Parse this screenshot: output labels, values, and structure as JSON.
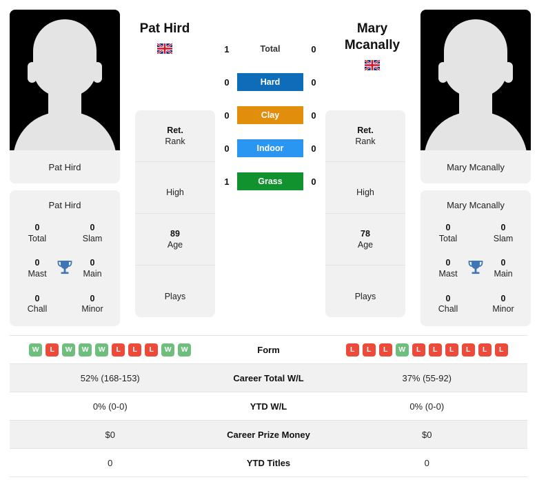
{
  "players": {
    "left": {
      "name": "Pat Hird",
      "name_line1": "Pat Hird",
      "name_line2": "",
      "photo_caption": "Pat Hird",
      "flag": "gb-flag-icon",
      "titles": [
        {
          "value": "0",
          "label": "Total"
        },
        {
          "value": "0",
          "label": "Slam"
        },
        {
          "value": "0",
          "label": "Mast"
        },
        {
          "value": "0",
          "label": "Main"
        },
        {
          "value": "0",
          "label": "Chall"
        },
        {
          "value": "0",
          "label": "Minor"
        }
      ],
      "info": [
        {
          "value": "Ret.",
          "label": "Rank"
        },
        {
          "value": "",
          "label": "High"
        },
        {
          "value": "89",
          "label": "Age"
        },
        {
          "value": "",
          "label": "Plays"
        }
      ],
      "form": [
        "W",
        "L",
        "W",
        "W",
        "W",
        "L",
        "L",
        "L",
        "W",
        "W"
      ],
      "career_total_wl": "52% (168-153)",
      "ytd_wl": "0% (0-0)",
      "career_prize_money": "$0",
      "ytd_titles": "0"
    },
    "right": {
      "name": "Mary Mcanally",
      "name_line1": "Mary",
      "name_line2": "Mcanally",
      "photo_caption": "Mary Mcanally",
      "flag": "gb-flag-icon",
      "titles": [
        {
          "value": "0",
          "label": "Total"
        },
        {
          "value": "0",
          "label": "Slam"
        },
        {
          "value": "0",
          "label": "Mast"
        },
        {
          "value": "0",
          "label": "Main"
        },
        {
          "value": "0",
          "label": "Chall"
        },
        {
          "value": "0",
          "label": "Minor"
        }
      ],
      "info": [
        {
          "value": "Ret.",
          "label": "Rank"
        },
        {
          "value": "",
          "label": "High"
        },
        {
          "value": "78",
          "label": "Age"
        },
        {
          "value": "",
          "label": "Plays"
        }
      ],
      "form": [
        "L",
        "L",
        "L",
        "W",
        "L",
        "L",
        "L",
        "L",
        "L",
        "L"
      ],
      "career_total_wl": "37% (55-92)",
      "ytd_wl": "0% (0-0)",
      "career_prize_money": "$0",
      "ytd_titles": "0"
    }
  },
  "head_to_head": [
    {
      "label": "Total",
      "left": "1",
      "right": "0",
      "color": "",
      "plain": true
    },
    {
      "label": "Hard",
      "left": "0",
      "right": "0",
      "color": "#0e6cb8",
      "plain": false
    },
    {
      "label": "Clay",
      "left": "0",
      "right": "0",
      "color": "#e08e0b",
      "plain": false
    },
    {
      "label": "Indoor",
      "left": "0",
      "right": "0",
      "color": "#2b96f2",
      "plain": false
    },
    {
      "label": "Grass",
      "left": "1",
      "right": "0",
      "color": "#12912f",
      "plain": false
    }
  ],
  "table": {
    "rows": [
      {
        "label": "Form",
        "left": "",
        "right": "",
        "type": "form",
        "shade": false
      },
      {
        "label": "Career Total W/L",
        "left": "52% (168-153)",
        "right": "37% (55-92)",
        "type": "text",
        "shade": true
      },
      {
        "label": "YTD W/L",
        "left": "0% (0-0)",
        "right": "0% (0-0)",
        "type": "text",
        "shade": false
      },
      {
        "label": "Career Prize Money",
        "left": "$0",
        "right": "$0",
        "type": "text",
        "shade": true
      },
      {
        "label": "YTD Titles",
        "left": "0",
        "right": "0",
        "type": "text",
        "shade": false
      }
    ]
  },
  "colors": {
    "win": "#6ebe7d",
    "loss": "#ee4a3a",
    "hard": "#0e6cb8",
    "clay": "#e08e0b",
    "indoor": "#2b96f2",
    "grass": "#12912f",
    "trophy": "#3f75b5",
    "card_bg": "#f1f1f1"
  }
}
